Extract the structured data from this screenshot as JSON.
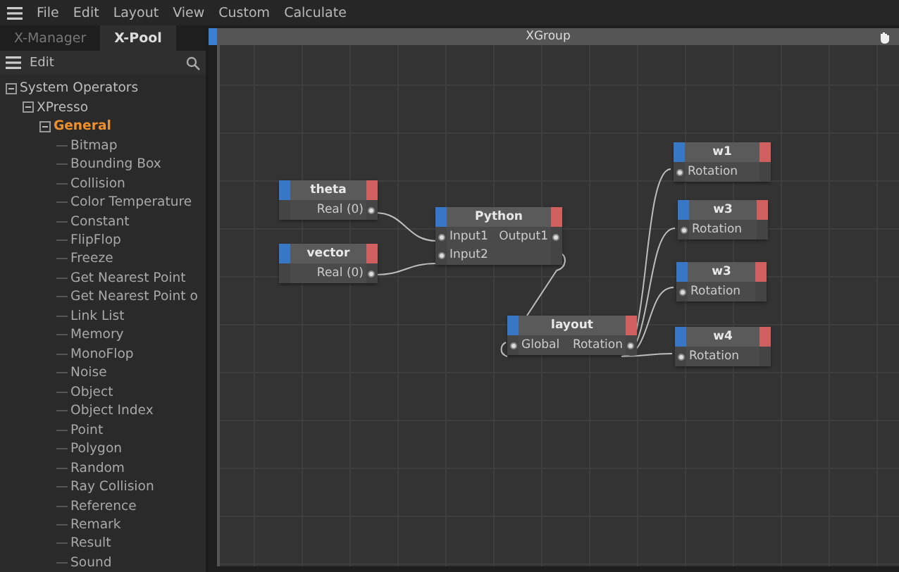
{
  "menu": [
    "File",
    "Edit",
    "Layout",
    "View",
    "Custom",
    "Calculate"
  ],
  "tabs": [
    {
      "label": "X-Manager",
      "selected": false
    },
    {
      "label": "X-Pool",
      "selected": true
    }
  ],
  "panel_toolbar": {
    "label": "Edit"
  },
  "tree": [
    {
      "label": "System Operators",
      "expanded": true,
      "selected": false,
      "children": [
        {
          "label": "XPresso",
          "expanded": true,
          "selected": false,
          "children": [
            {
              "label": "General",
              "expanded": true,
              "selected": true,
              "children": [
                {
                  "label": "Bitmap"
                },
                {
                  "label": "Bounding Box"
                },
                {
                  "label": "Collision"
                },
                {
                  "label": "Color Temperature"
                },
                {
                  "label": "Constant"
                },
                {
                  "label": "FlipFlop"
                },
                {
                  "label": "Freeze"
                },
                {
                  "label": "Get Nearest Point"
                },
                {
                  "label": "Get Nearest Point o"
                },
                {
                  "label": "Link List"
                },
                {
                  "label": "Memory"
                },
                {
                  "label": "MonoFlop"
                },
                {
                  "label": "Noise"
                },
                {
                  "label": "Object"
                },
                {
                  "label": "Object Index"
                },
                {
                  "label": "Point"
                },
                {
                  "label": "Polygon"
                },
                {
                  "label": "Random"
                },
                {
                  "label": "Ray Collision"
                },
                {
                  "label": "Reference"
                },
                {
                  "label": "Remark"
                },
                {
                  "label": "Result"
                },
                {
                  "label": "Sound"
                }
              ]
            }
          ]
        }
      ]
    }
  ],
  "canvas": {
    "title": "XGroup",
    "nodes": [
      {
        "title": "theta",
        "outputs": [
          "Real (0)"
        ]
      },
      {
        "title": "vector",
        "outputs": [
          "Real (0)"
        ]
      },
      {
        "title": "Python",
        "inputs": [
          "Input1",
          "Input2"
        ],
        "outputs": [
          "Output1"
        ]
      },
      {
        "title": "layout",
        "inputs": [
          "Global"
        ],
        "outputs": [
          "Rotation"
        ]
      },
      {
        "title": "w1",
        "inputs": [
          "Rotation"
        ]
      },
      {
        "title": "w3",
        "inputs": [
          "Rotation"
        ]
      },
      {
        "title": "w3",
        "inputs": [
          "Rotation"
        ]
      },
      {
        "title": "w4",
        "inputs": [
          "Rotation"
        ]
      }
    ]
  }
}
